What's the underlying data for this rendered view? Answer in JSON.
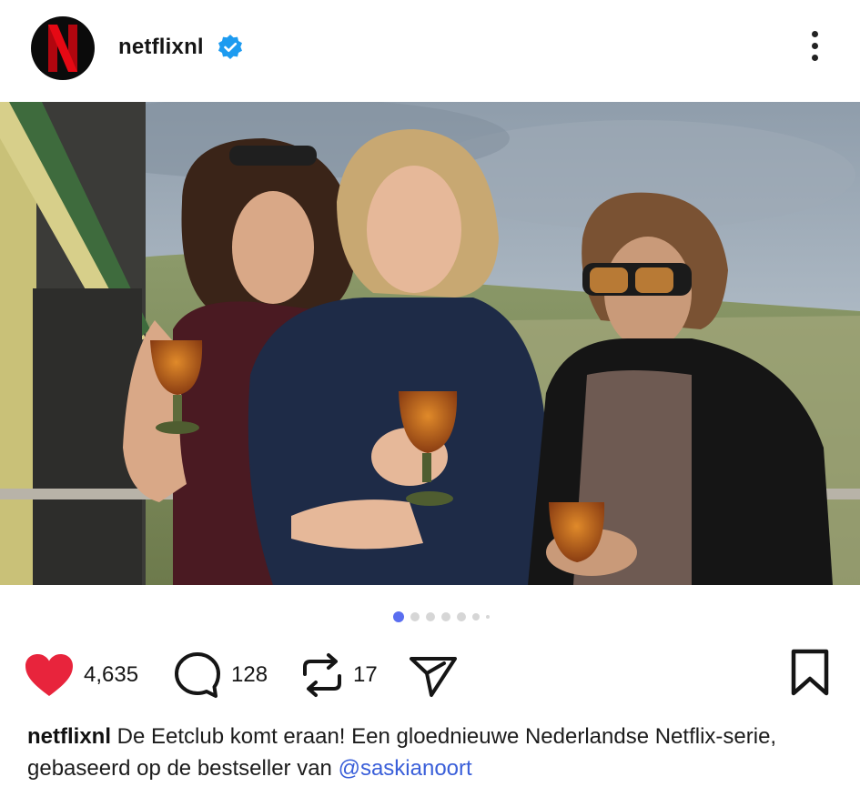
{
  "post": {
    "username": "netflixnl",
    "verified": true,
    "avatar_letter": "N",
    "brand_color": "#e50914",
    "carousel": {
      "total_dots": 7,
      "active_index": 0
    }
  },
  "actions": {
    "likes": "4,635",
    "comments": "128",
    "reposts": "17",
    "like_color": "#e8243c"
  },
  "caption": {
    "username": "netflixnl",
    "text": " De Eetclub komt eraan! Een gloednieuwe Nederlandse Netflix-serie, gebaseerd op de bestseller van ",
    "mention": "@saskianoort"
  }
}
